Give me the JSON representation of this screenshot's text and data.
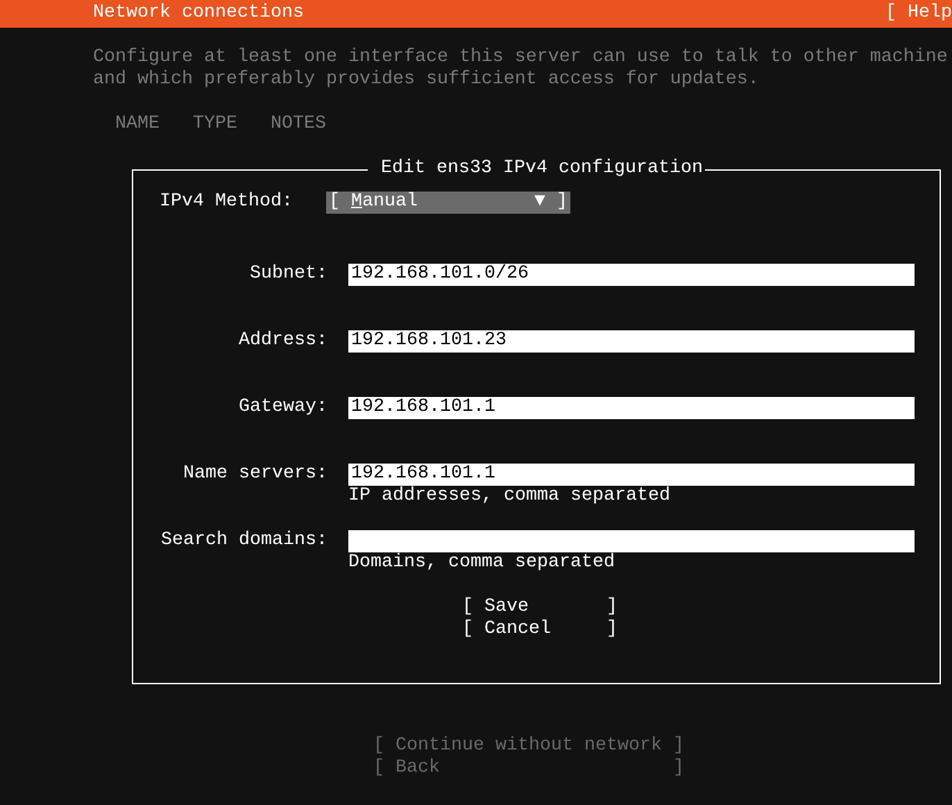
{
  "header": {
    "title": "Network connections",
    "help": "[ Help"
  },
  "description": [
    "Configure at least one interface this server can use to talk to other machine",
    "and which preferably provides sufficient access for updates."
  ],
  "columns": [
    "NAME",
    "TYPE",
    "NOTES"
  ],
  "dialog": {
    "title": "Edit ens33 IPv4 configuration",
    "method": {
      "label": "IPv4 Method:",
      "left": "[",
      "value": "Manual",
      "arrow": "▼",
      "right": "]"
    },
    "fields": [
      {
        "label": "Subnet:",
        "value": "192.168.101.0/26"
      },
      {
        "label": "Address:",
        "value": "192.168.101.23"
      },
      {
        "label": "Gateway:",
        "value": "192.168.101.1"
      },
      {
        "label": "Name servers:",
        "value": "192.168.101.1",
        "hint": "IP addresses, comma separated"
      },
      {
        "label": "Search domains:",
        "hint": "Domains, comma separated"
      }
    ],
    "buttons": [
      {
        "label": "[ Save       ]",
        "disabled": false
      },
      {
        "label": "[ Cancel     ]",
        "disabled": false
      }
    ]
  },
  "footer_buttons": [
    {
      "label": "[ Continue without network ]",
      "disabled": true
    },
    {
      "label": "[ Back                     ]",
      "disabled": true
    }
  ]
}
